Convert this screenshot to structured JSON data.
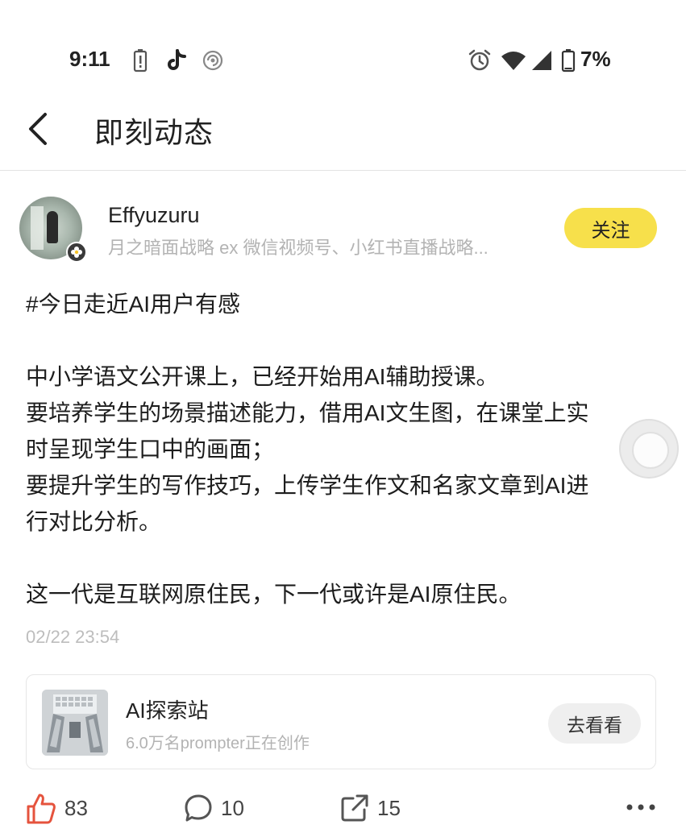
{
  "status_bar": {
    "time": "9:11",
    "battery_percent": "7%",
    "icons": [
      "battery-alert-icon",
      "tiktok-icon",
      "swirl-app-icon",
      "alarm-icon",
      "wifi-icon",
      "cellular-signal-icon",
      "battery-icon"
    ]
  },
  "header": {
    "title": "即刻动态",
    "back_icon": "chevron-left-icon"
  },
  "author": {
    "name": "Effyuzuru",
    "description": "月之暗面战略 ex 微信视频号、小红书直播战略...",
    "follow_label": "关注",
    "badge_icon": "flower-badge-icon"
  },
  "post": {
    "lines": [
      "#今日走近AI用户有感",
      "",
      "中小学语文公开课上，已经开始用AI辅助授课。",
      "要培养学生的场景描述能力，借用AI文生图，在课堂上实",
      "时呈现学生口中的画面；",
      "要提升学生的写作技巧，上传学生作文和名家文章到AI进",
      "行对比分析。",
      "",
      "这一代是互联网原住民，下一代或许是AI原住民。"
    ],
    "timestamp": "02/22 23:54"
  },
  "topic_card": {
    "title": "AI探索站",
    "subtitle": "6.0万名prompter正在创作",
    "button_label": "去看看"
  },
  "actions": {
    "likes": "83",
    "comments": "10",
    "shares": "15"
  },
  "colors": {
    "accent_yellow": "#f7e04b",
    "like_red": "#e5533d",
    "muted_text": "#b3b3b3"
  }
}
